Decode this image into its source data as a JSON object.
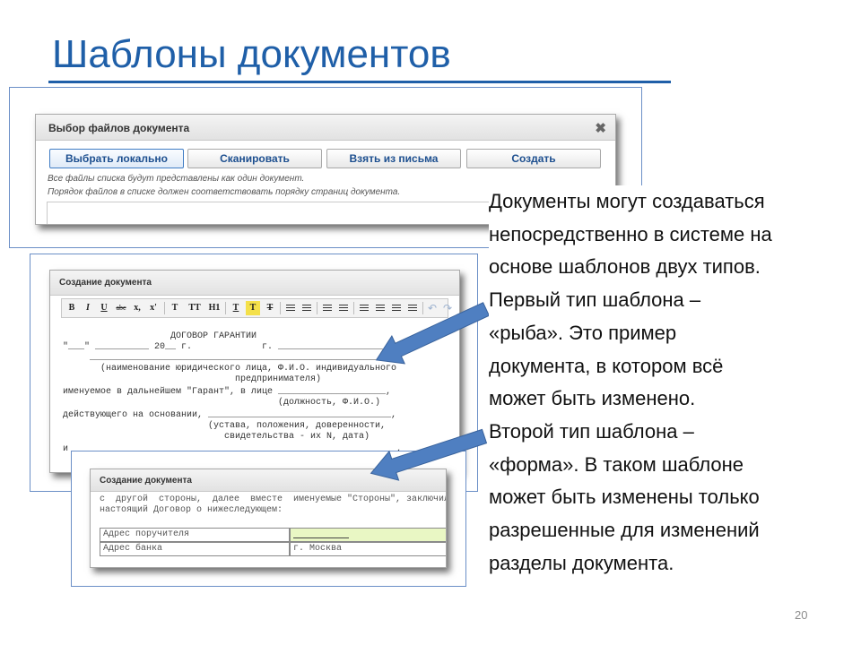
{
  "slide": {
    "title": "Шаблоны документов",
    "page_number": "20",
    "description_lines": [
      "Документы могут создаваться",
      "непосредственно в системе на",
      "основе шаблонов двух типов.",
      "Первый тип шаблона –",
      "«рыба». Это пример",
      "документа, в котором всё",
      "может быть изменено.",
      "Второй тип шаблона –",
      "«форма».  В таком шаблоне",
      "может быть изменены только",
      "разрешенные для изменений",
      "разделы документа."
    ],
    "arrow_color": "#4f7fc1"
  },
  "file_dialog": {
    "title": "Выбор файлов документа",
    "close_icon": "close-icon",
    "buttons": {
      "local": "Выбрать локально",
      "scan": "Сканировать",
      "from_letter": "Взять из письма",
      "create": "Создать"
    },
    "note1": "Все файлы списка будут представлены как один документ.",
    "note2": "Порядок файлов в списке должен соответствовать порядку страниц документа."
  },
  "editor_dialog": {
    "title": "Создание документа",
    "toolbar": {
      "bold": "B",
      "italic": "I",
      "underline": "U",
      "strike": "abc",
      "subscript": "x,",
      "superscript": "x'",
      "font": "T",
      "font_size": "TT",
      "heading": "H1",
      "text_color": "T",
      "highlight": "T",
      "clear_format": "T"
    },
    "body_lines": [
      "                    ДОГОВОР ГАРАНТИИ",
      "\"___\" __________ 20__ г.             г. ____________________",
      "     ________________________________________________________",
      "       (наименование юридического лица, Ф.И.О. индивидуального",
      "                                предпринимателя)",
      "именуемое в дальнейшем \"Гарант\", в лице ____________________,",
      "                                        (должность, Ф.И.О.)",
      "действующего на основании, __________________________________,",
      "                           (устава, положения, доверенности,",
      "                              свидетельства - их N, дата)",
      "и ____________________________________________________________,"
    ]
  },
  "form_dialog": {
    "title": "Создание документа",
    "text_line1": "с  другой  стороны,  далее  вместе  именуемые \"Стороны\", заключили",
    "text_line2": "настоящий Договор о нижеследующем:",
    "rows": [
      {
        "label": "Адрес поручителя",
        "value": ""
      },
      {
        "label": "Адрес банка",
        "value": "г. Москва"
      }
    ],
    "editable_highlight_color": "#e9f7c4"
  }
}
